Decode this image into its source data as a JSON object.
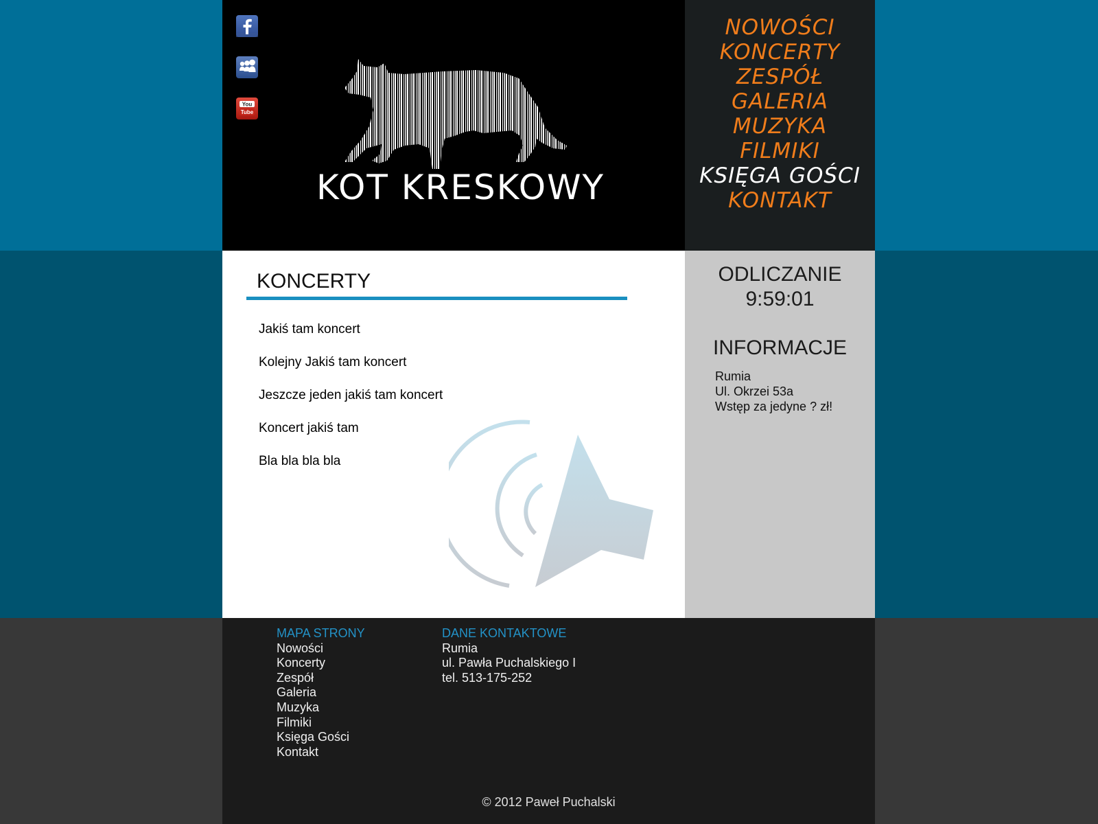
{
  "site": {
    "logo_text": "KOT KRESKOWY",
    "social": [
      "facebook-icon",
      "myspace-icon",
      "youtube-icon"
    ],
    "youtube_text": [
      "You",
      "Tube"
    ]
  },
  "nav": {
    "items": [
      {
        "label": "NOWOŚCI"
      },
      {
        "label": "KONCERTY"
      },
      {
        "label": "ZESPÓŁ"
      },
      {
        "label": "GALERIA"
      },
      {
        "label": "MUZYKA"
      },
      {
        "label": "FILMIKI"
      },
      {
        "label": "KSIĘGA GOŚCI"
      },
      {
        "label": "KONTAKT"
      }
    ]
  },
  "main": {
    "title": "KONCERTY",
    "concerts": [
      "Jakiś tam koncert",
      "Kolejny Jakiś tam koncert",
      "Jeszcze jeden jakiś tam koncert",
      "Koncert jakiś tam",
      "Bla bla bla bla"
    ]
  },
  "sidebar": {
    "countdown_label": "ODLICZANIE",
    "countdown_time": "9:59:01",
    "info_title": "INFORMACJE",
    "info_lines": [
      "Rumia",
      "Ul. Okrzei 53a",
      "Wstęp za jedyne ? zł!"
    ]
  },
  "footer": {
    "map_title": "MAPA STRONY",
    "map_links": [
      "Nowości",
      "Koncerty",
      "Zespół",
      "Galeria",
      "Muzyka",
      "Filmiki",
      "Księga Gości",
      "Kontakt"
    ],
    "contact_title": "DANE KONTAKTOWE",
    "contact_lines": [
      "Rumia",
      "ul. Pawła Puchalskiego I",
      "tel. 513-175-252"
    ],
    "copyright": "© 2012 Paweł Puchalski"
  },
  "colors": {
    "accent_orange": "#f07d1b",
    "accent_blue": "#1a8fc0",
    "bg_top": "#006f98",
    "bg_mid": "#00536f"
  }
}
